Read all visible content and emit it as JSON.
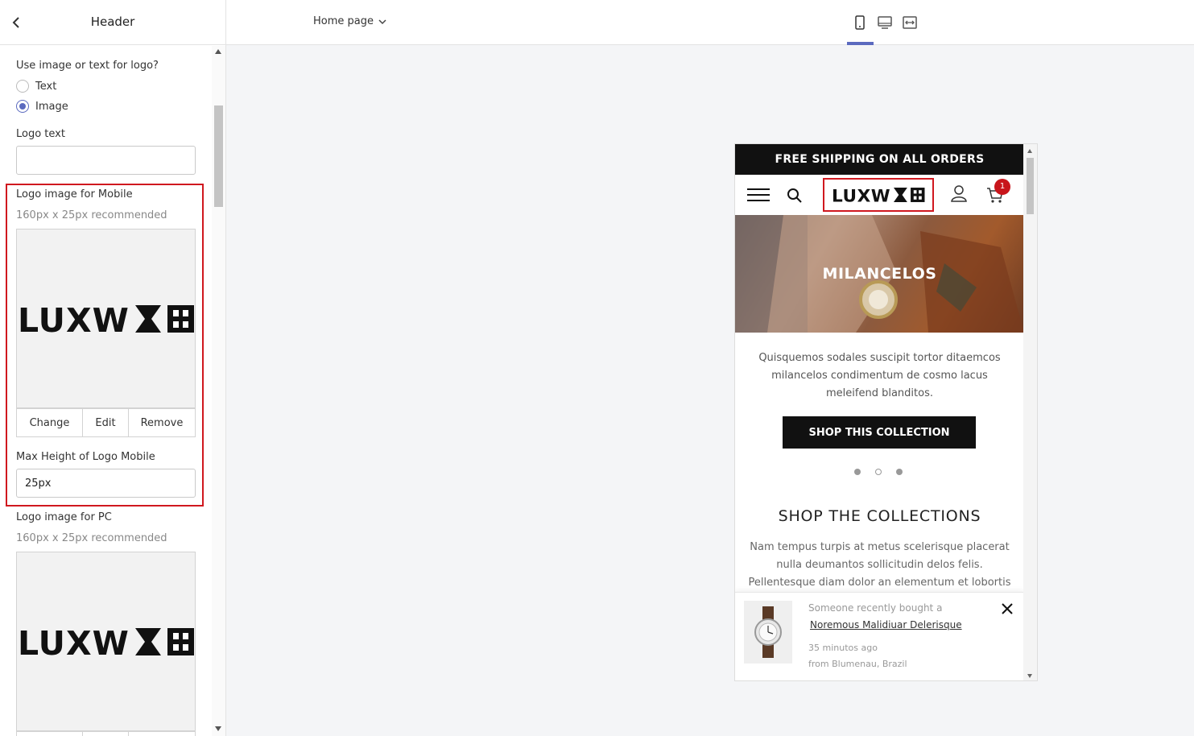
{
  "sidebar": {
    "title": "Header",
    "logo_type_question": "Use image or text for logo?",
    "radio_options": [
      "Text",
      "Image"
    ],
    "selected_option": "Image",
    "logo_text_label": "Logo text",
    "logo_text_value": "",
    "mobile_logo_label": "Logo image for Mobile",
    "mobile_logo_hint": "160px x 25px recommended",
    "image_buttons": [
      "Change",
      "Edit",
      "Remove"
    ],
    "max_height_label": "Max Height of Logo Mobile",
    "max_height_value": "25px",
    "pc_logo_label": "Logo image for PC",
    "pc_logo_hint": "160px x 25px recommended",
    "logo_wordmark": "LUXW"
  },
  "topbar": {
    "page_selector": "Home page",
    "device_icons": [
      "mobile-icon",
      "desktop-icon",
      "fullwidth-icon"
    ],
    "active_device": "mobile-icon"
  },
  "preview": {
    "announcement": "FREE SHIPPING ON ALL ORDERS",
    "cart_count": "1",
    "hero_title": "MILANCELOS",
    "hero_text": "Quisquemos sodales suscipit tortor ditaemcos milancelos condimentum de cosmo lacus meleifend blanditos.",
    "hero_button": "SHOP THIS COLLECTION",
    "slide_dots": 3,
    "active_slide": 2,
    "section_title": "SHOP THE COLLECTIONS",
    "section_text": "Nam tempus turpis at metus scelerisque placerat nulla deumantos sollicitudin delos felis. Pellentesque diam dolor an elementum et lobortis at mollis ut",
    "popup": {
      "line1": "Someone recently bought a",
      "product": "Noremous Malidiuar Delerisque",
      "time": "35 minutos ago",
      "location": "from Blumenau, Brazil"
    }
  },
  "colors": {
    "accent": "#5b6abf",
    "highlight": "#d0181f",
    "badge": "#c8151b"
  }
}
